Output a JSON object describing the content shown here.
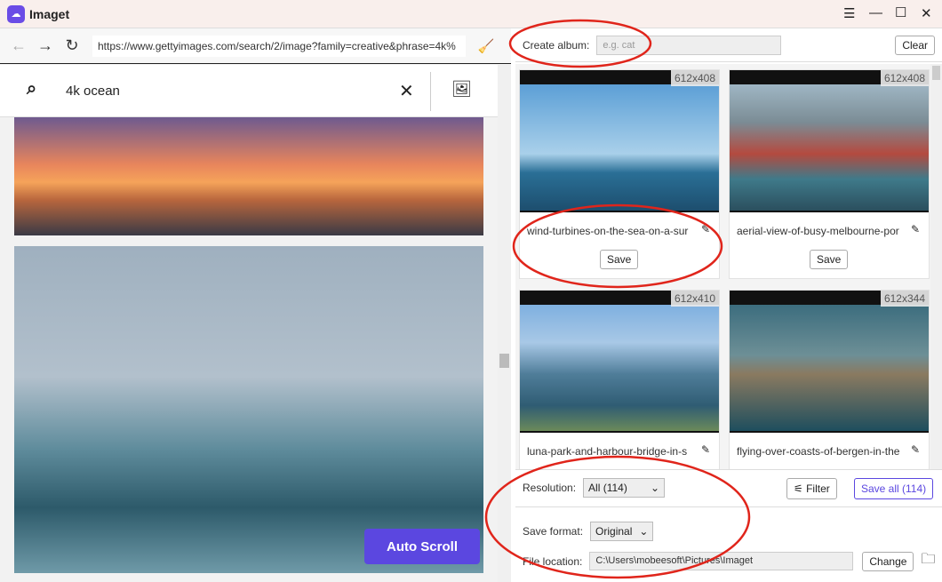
{
  "app": {
    "title": "Imaget"
  },
  "browser": {
    "url": "https://www.gettyimages.com/search/2/image?family=creative&phrase=4k%",
    "search_query": "4k ocean",
    "auto_scroll": "Auto Scroll"
  },
  "album": {
    "label": "Create album:",
    "placeholder": "e.g. cat",
    "clear": "Clear"
  },
  "cards": [
    {
      "resolution": "612x408",
      "name": "wind-turbines-on-the-sea-on-a-sur",
      "save": "Save"
    },
    {
      "resolution": "612x408",
      "name": "aerial-view-of-busy-melbourne-por",
      "save": "Save"
    },
    {
      "resolution": "612x410",
      "name": "luna-park-and-harbour-bridge-in-s"
    },
    {
      "resolution": "612x344",
      "name": "flying-over-coasts-of-bergen-in-the"
    }
  ],
  "bottom": {
    "resolution_label": "Resolution:",
    "resolution_value": "All (114)",
    "filter": "Filter",
    "save_all": "Save all (114)",
    "format_label": "Save format:",
    "format_value": "Original",
    "location_label": "File location:",
    "location_value": "C:\\Users\\mobeesoft\\Pictures\\Imaget",
    "change": "Change"
  },
  "colors": {
    "accent": "#5b47e0",
    "annotation": "#e0251b"
  }
}
